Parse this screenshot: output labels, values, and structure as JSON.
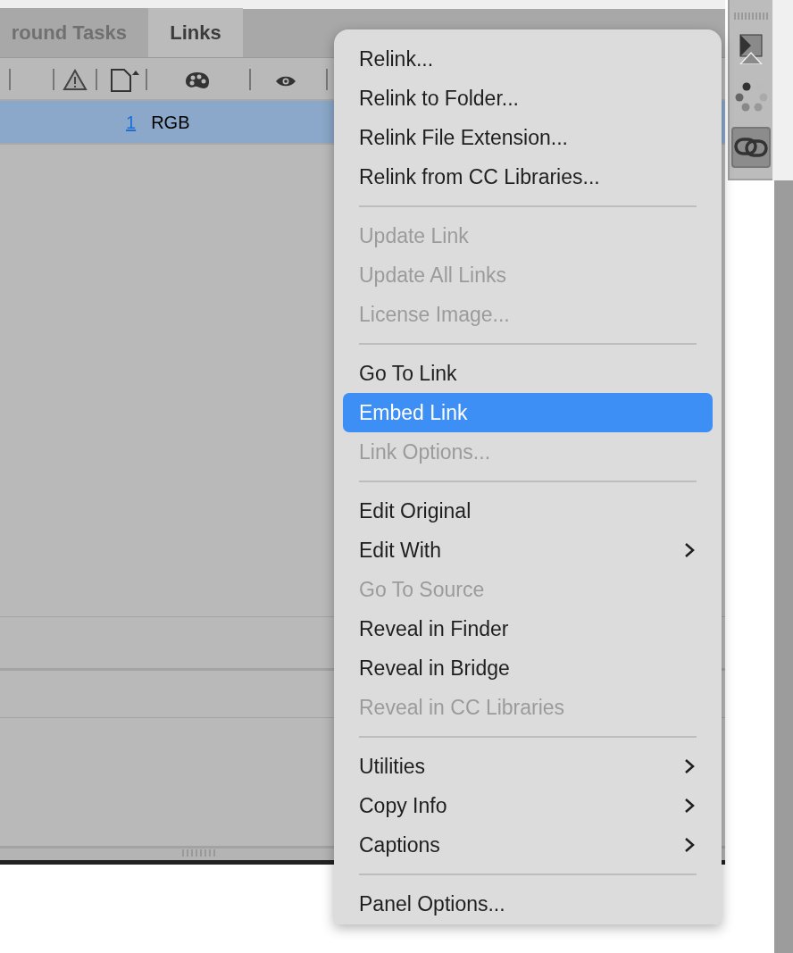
{
  "tabs": [
    {
      "label": "round Tasks",
      "selected": false
    },
    {
      "label": "Links",
      "selected": true
    }
  ],
  "table": {
    "rows": [
      {
        "number": "1",
        "color_space": "RGB",
        "selected": true
      }
    ]
  },
  "context_menu": {
    "sections": [
      [
        {
          "label": "Relink...",
          "disabled": false,
          "selected": false,
          "submenu": false
        },
        {
          "label": "Relink to Folder...",
          "disabled": false,
          "selected": false,
          "submenu": false
        },
        {
          "label": "Relink File Extension...",
          "disabled": false,
          "selected": false,
          "submenu": false
        },
        {
          "label": "Relink from CC Libraries...",
          "disabled": false,
          "selected": false,
          "submenu": false
        }
      ],
      [
        {
          "label": "Update Link",
          "disabled": true,
          "selected": false,
          "submenu": false
        },
        {
          "label": "Update All Links",
          "disabled": true,
          "selected": false,
          "submenu": false
        },
        {
          "label": "License Image...",
          "disabled": true,
          "selected": false,
          "submenu": false
        }
      ],
      [
        {
          "label": "Go To Link",
          "disabled": false,
          "selected": false,
          "submenu": false
        },
        {
          "label": "Embed Link",
          "disabled": false,
          "selected": true,
          "submenu": false
        },
        {
          "label": "Link Options...",
          "disabled": true,
          "selected": false,
          "submenu": false
        }
      ],
      [
        {
          "label": "Edit Original",
          "disabled": false,
          "selected": false,
          "submenu": false
        },
        {
          "label": "Edit With",
          "disabled": false,
          "selected": false,
          "submenu": true
        },
        {
          "label": "Go To Source",
          "disabled": true,
          "selected": false,
          "submenu": false
        },
        {
          "label": "Reveal in Finder",
          "disabled": false,
          "selected": false,
          "submenu": false
        },
        {
          "label": "Reveal in Bridge",
          "disabled": false,
          "selected": false,
          "submenu": false
        },
        {
          "label": "Reveal in CC Libraries",
          "disabled": true,
          "selected": false,
          "submenu": false
        }
      ],
      [
        {
          "label": "Utilities",
          "disabled": false,
          "selected": false,
          "submenu": true
        },
        {
          "label": "Copy Info",
          "disabled": false,
          "selected": false,
          "submenu": true
        },
        {
          "label": "Captions",
          "disabled": false,
          "selected": false,
          "submenu": true
        }
      ],
      [
        {
          "label": "Panel Options...",
          "disabled": false,
          "selected": false,
          "submenu": false
        }
      ]
    ]
  },
  "dock": {
    "items": [
      {
        "kind": "hourglass",
        "selected": false
      },
      {
        "kind": "spinner",
        "selected": false
      },
      {
        "kind": "link",
        "selected": true
      }
    ]
  }
}
